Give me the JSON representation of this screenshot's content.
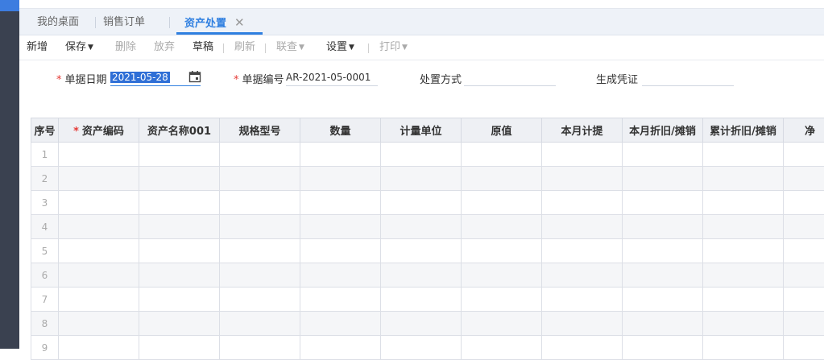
{
  "tabs": [
    {
      "label": "我的桌面"
    },
    {
      "label": "销售订单"
    },
    {
      "label": "资产处置",
      "active": true
    }
  ],
  "tab_close_glyph": "✕",
  "toolbar": {
    "new": "新增",
    "save": "保存",
    "delete": "删除",
    "discard": "放弃",
    "draft": "草稿",
    "refresh": "刷新",
    "linked_query": "联查",
    "settings": "设置",
    "print": "打印"
  },
  "form": {
    "doc_date_label": "单据日期",
    "doc_date_value": "2021-05-28",
    "doc_no_label": "单据编号",
    "doc_no_value": "AR-2021-05-0001",
    "disposal_method_label": "处置方式",
    "disposal_method_value": "",
    "voucher_label": "生成凭证",
    "voucher_value": ""
  },
  "table": {
    "columns": [
      {
        "label": "序号"
      },
      {
        "label": "资产编码",
        "required": true
      },
      {
        "label": "资产名称001"
      },
      {
        "label": "规格型号"
      },
      {
        "label": "数量"
      },
      {
        "label": "计量单位"
      },
      {
        "label": "原值"
      },
      {
        "label": "本月计提"
      },
      {
        "label": "本月折旧/摊销"
      },
      {
        "label": "累计折旧/摊销"
      },
      {
        "label": "净"
      }
    ],
    "rows": [
      "1",
      "2",
      "3",
      "4",
      "5",
      "6",
      "7",
      "8",
      "9"
    ]
  },
  "colors": {
    "accent": "#2f7fe0",
    "required": "#e53935",
    "sidebar": "#3a4150"
  }
}
